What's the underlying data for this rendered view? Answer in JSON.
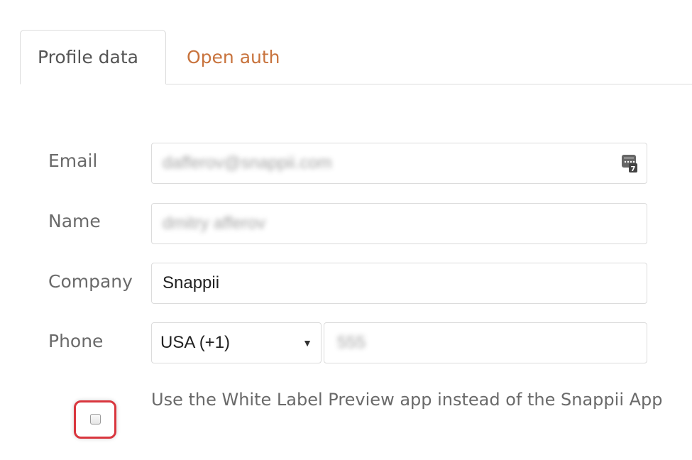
{
  "tabs": {
    "profile": "Profile data",
    "open_auth": "Open auth"
  },
  "form": {
    "email": {
      "label": "Email",
      "value": "dafferov@snappii.com",
      "icon": "password-manager-icon"
    },
    "name": {
      "label": "Name",
      "value": "dmitry afferov"
    },
    "company": {
      "label": "Company",
      "value": "Snappii"
    },
    "phone": {
      "label": "Phone",
      "country": "USA (+1)",
      "number": "555"
    }
  },
  "checkbox": {
    "label": "Use the White Label Preview app instead of the Snappii App",
    "checked": false
  },
  "colors": {
    "link": "#c8733d",
    "highlight": "#d9363e",
    "border": "#dcdcdc",
    "label": "#6a6a6a"
  }
}
